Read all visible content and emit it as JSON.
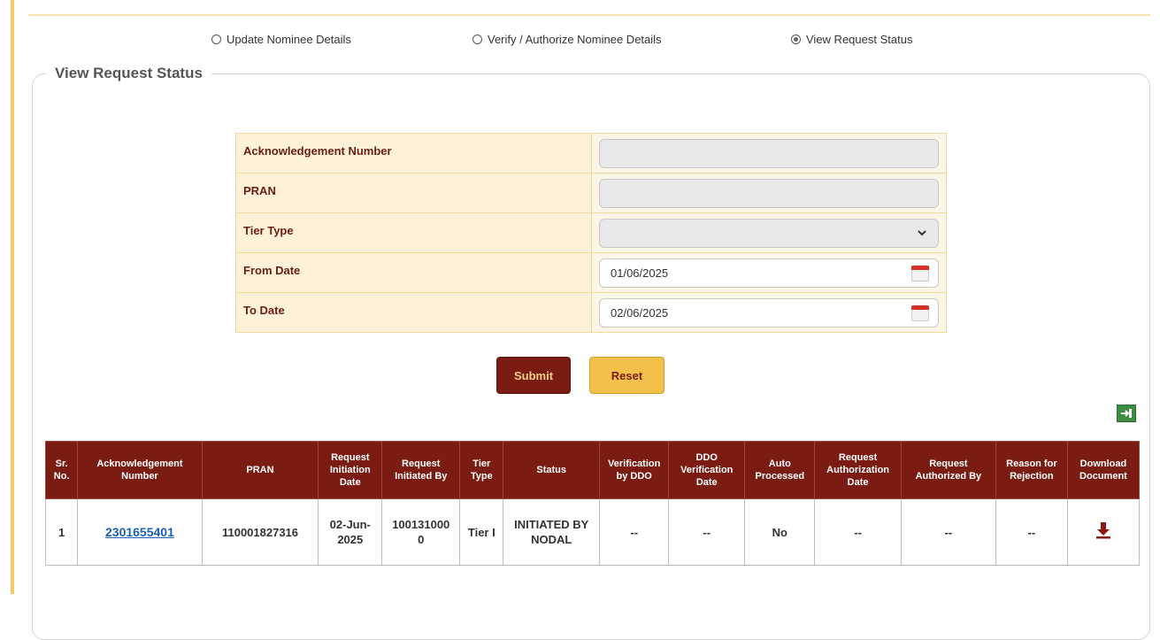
{
  "options": {
    "update": "Update Nominee Details",
    "verify": "Verify / Authorize Nominee Details",
    "view": "View Request Status"
  },
  "legend": "View Request Status",
  "form": {
    "ack_label": "Acknowledgement Number",
    "ack_value": "",
    "pran_label": "PRAN",
    "pran_value": "",
    "tier_label": "Tier Type",
    "tier_value": "",
    "from_label": "From Date",
    "from_value": "01/06/2025",
    "to_label": "To Date",
    "to_value": "02/06/2025"
  },
  "buttons": {
    "submit": "Submit",
    "reset": "Reset"
  },
  "icons": {
    "excel": "excel-export-icon",
    "download": "download-icon",
    "calendar": "calendar-icon",
    "dropdown": "chevron-down-icon"
  },
  "table": {
    "headers": [
      "Sr. No.",
      "Acknowledgement Number",
      "PRAN",
      "Request Initiation Date",
      "Request Initiated By",
      "Tier Type",
      "Status",
      "Verification by DDO",
      "DDO Verification Date",
      "Auto Processed",
      "Request Authorization Date",
      "Request Authorized By",
      "Reason for Rejection",
      "Download Document"
    ],
    "rows": [
      {
        "sr": "1",
        "ack": "2301655401",
        "pran": "110001827316",
        "date": "02-Jun-2025",
        "initiated_by": "1001310000",
        "tier": "Tier I",
        "status": "INITIATED BY NODAL",
        "verification_ddo": "--",
        "ddo_verif_date": "--",
        "auto": "No",
        "auth_date": "--",
        "auth_by": "--",
        "reason": "--"
      }
    ]
  },
  "colors": {
    "header_bg": "#7a1c12",
    "label_text": "#6b1f12",
    "form_bg": "#fdf1d8",
    "reset_bg": "#f3c04c"
  }
}
